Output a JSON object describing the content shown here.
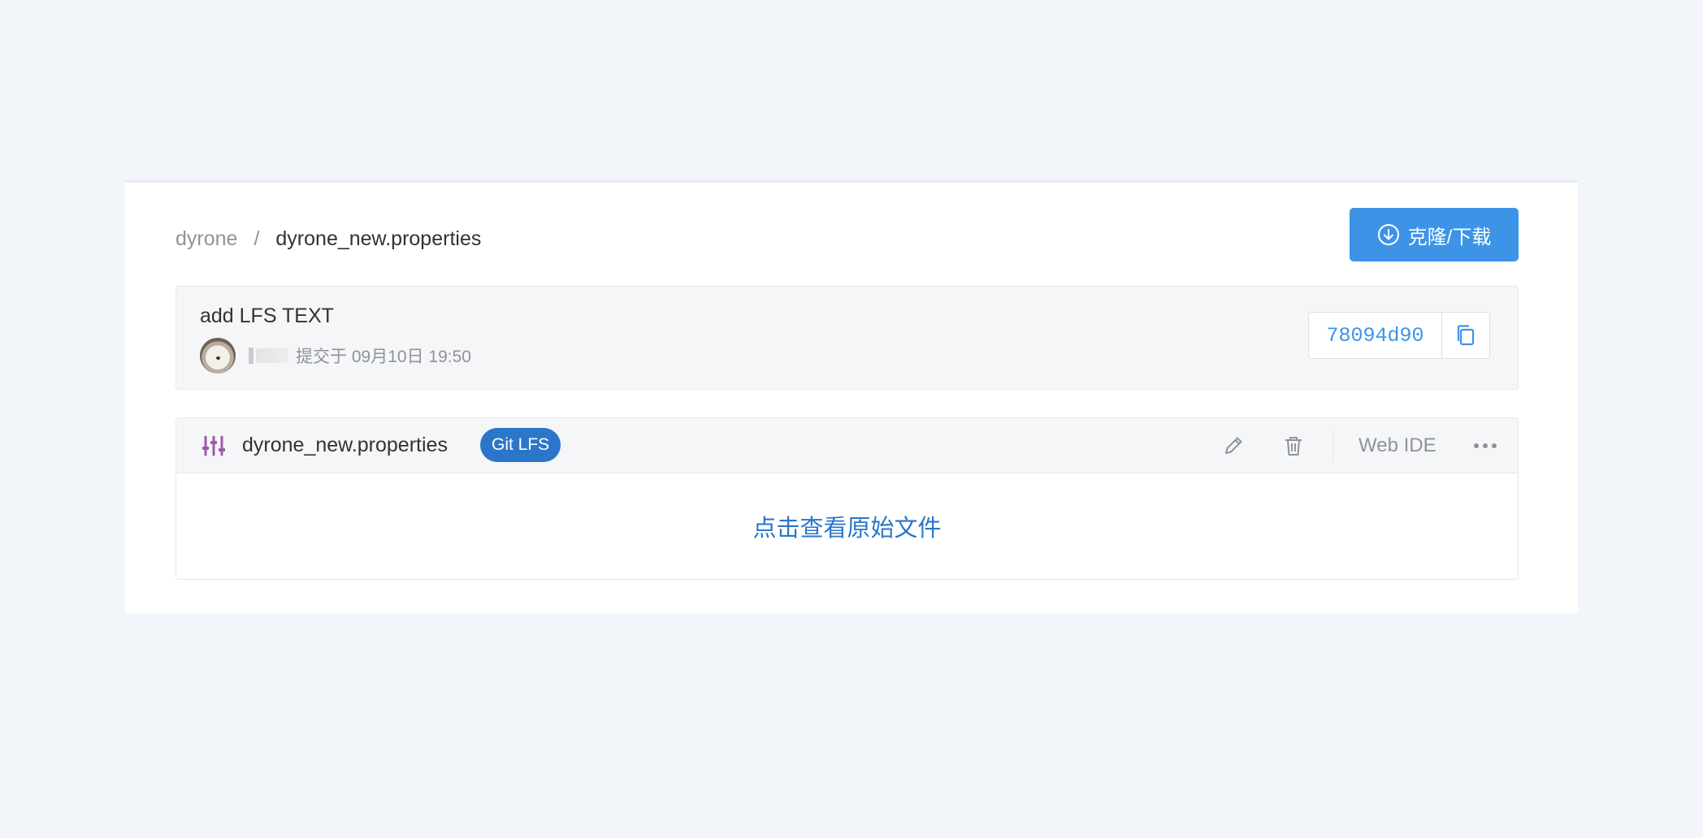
{
  "breadcrumb": {
    "root": "dyrone",
    "separator": "/",
    "file": "dyrone_new.properties"
  },
  "clone_button": {
    "label": "克隆/下载",
    "icon": "download-circle-icon"
  },
  "commit": {
    "message": "add LFS TEXT",
    "author_prefix": "",
    "committed_text": "提交于 09月10日 19:50",
    "hash": "78094d90",
    "copy_icon": "copy-icon"
  },
  "file": {
    "icon": "properties-file-icon",
    "name": "dyrone_new.properties",
    "badge": "Git LFS",
    "tools": {
      "edit_icon": "pencil-icon",
      "delete_icon": "trash-icon",
      "web_ide": "Web IDE",
      "more_icon": "more-icon"
    },
    "view_raw": "点击查看原始文件"
  },
  "colors": {
    "accent": "#3d94e6",
    "badge": "#2b76c9",
    "file_icon": "#9b5ca8",
    "background": "#f2f6fa"
  }
}
